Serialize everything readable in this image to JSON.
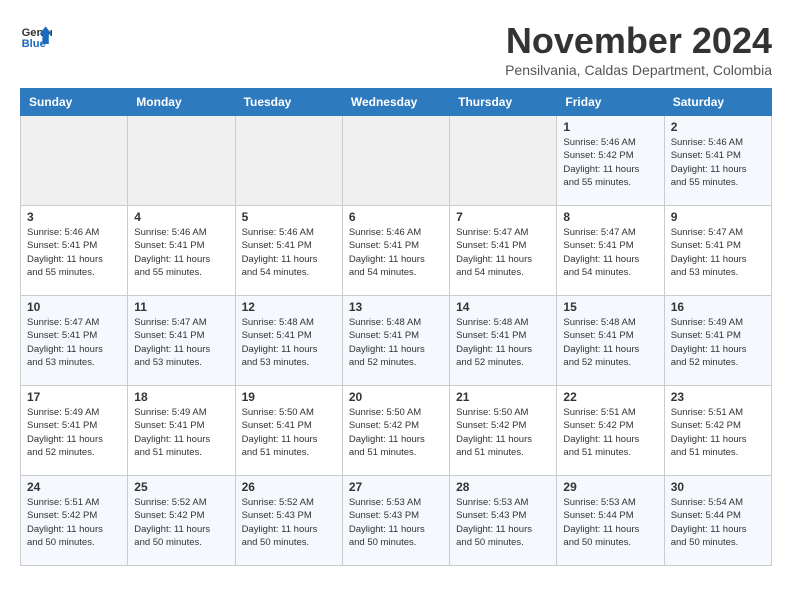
{
  "header": {
    "logo_general": "General",
    "logo_blue": "Blue",
    "month": "November 2024",
    "location": "Pensilvania, Caldas Department, Colombia"
  },
  "weekdays": [
    "Sunday",
    "Monday",
    "Tuesday",
    "Wednesday",
    "Thursday",
    "Friday",
    "Saturday"
  ],
  "weeks": [
    [
      {
        "day": "",
        "info": ""
      },
      {
        "day": "",
        "info": ""
      },
      {
        "day": "",
        "info": ""
      },
      {
        "day": "",
        "info": ""
      },
      {
        "day": "",
        "info": ""
      },
      {
        "day": "1",
        "info": "Sunrise: 5:46 AM\nSunset: 5:42 PM\nDaylight: 11 hours and 55 minutes."
      },
      {
        "day": "2",
        "info": "Sunrise: 5:46 AM\nSunset: 5:41 PM\nDaylight: 11 hours and 55 minutes."
      }
    ],
    [
      {
        "day": "3",
        "info": "Sunrise: 5:46 AM\nSunset: 5:41 PM\nDaylight: 11 hours and 55 minutes."
      },
      {
        "day": "4",
        "info": "Sunrise: 5:46 AM\nSunset: 5:41 PM\nDaylight: 11 hours and 55 minutes."
      },
      {
        "day": "5",
        "info": "Sunrise: 5:46 AM\nSunset: 5:41 PM\nDaylight: 11 hours and 54 minutes."
      },
      {
        "day": "6",
        "info": "Sunrise: 5:46 AM\nSunset: 5:41 PM\nDaylight: 11 hours and 54 minutes."
      },
      {
        "day": "7",
        "info": "Sunrise: 5:47 AM\nSunset: 5:41 PM\nDaylight: 11 hours and 54 minutes."
      },
      {
        "day": "8",
        "info": "Sunrise: 5:47 AM\nSunset: 5:41 PM\nDaylight: 11 hours and 54 minutes."
      },
      {
        "day": "9",
        "info": "Sunrise: 5:47 AM\nSunset: 5:41 PM\nDaylight: 11 hours and 53 minutes."
      }
    ],
    [
      {
        "day": "10",
        "info": "Sunrise: 5:47 AM\nSunset: 5:41 PM\nDaylight: 11 hours and 53 minutes."
      },
      {
        "day": "11",
        "info": "Sunrise: 5:47 AM\nSunset: 5:41 PM\nDaylight: 11 hours and 53 minutes."
      },
      {
        "day": "12",
        "info": "Sunrise: 5:48 AM\nSunset: 5:41 PM\nDaylight: 11 hours and 53 minutes."
      },
      {
        "day": "13",
        "info": "Sunrise: 5:48 AM\nSunset: 5:41 PM\nDaylight: 11 hours and 52 minutes."
      },
      {
        "day": "14",
        "info": "Sunrise: 5:48 AM\nSunset: 5:41 PM\nDaylight: 11 hours and 52 minutes."
      },
      {
        "day": "15",
        "info": "Sunrise: 5:48 AM\nSunset: 5:41 PM\nDaylight: 11 hours and 52 minutes."
      },
      {
        "day": "16",
        "info": "Sunrise: 5:49 AM\nSunset: 5:41 PM\nDaylight: 11 hours and 52 minutes."
      }
    ],
    [
      {
        "day": "17",
        "info": "Sunrise: 5:49 AM\nSunset: 5:41 PM\nDaylight: 11 hours and 52 minutes."
      },
      {
        "day": "18",
        "info": "Sunrise: 5:49 AM\nSunset: 5:41 PM\nDaylight: 11 hours and 51 minutes."
      },
      {
        "day": "19",
        "info": "Sunrise: 5:50 AM\nSunset: 5:41 PM\nDaylight: 11 hours and 51 minutes."
      },
      {
        "day": "20",
        "info": "Sunrise: 5:50 AM\nSunset: 5:42 PM\nDaylight: 11 hours and 51 minutes."
      },
      {
        "day": "21",
        "info": "Sunrise: 5:50 AM\nSunset: 5:42 PM\nDaylight: 11 hours and 51 minutes."
      },
      {
        "day": "22",
        "info": "Sunrise: 5:51 AM\nSunset: 5:42 PM\nDaylight: 11 hours and 51 minutes."
      },
      {
        "day": "23",
        "info": "Sunrise: 5:51 AM\nSunset: 5:42 PM\nDaylight: 11 hours and 51 minutes."
      }
    ],
    [
      {
        "day": "24",
        "info": "Sunrise: 5:51 AM\nSunset: 5:42 PM\nDaylight: 11 hours and 50 minutes."
      },
      {
        "day": "25",
        "info": "Sunrise: 5:52 AM\nSunset: 5:42 PM\nDaylight: 11 hours and 50 minutes."
      },
      {
        "day": "26",
        "info": "Sunrise: 5:52 AM\nSunset: 5:43 PM\nDaylight: 11 hours and 50 minutes."
      },
      {
        "day": "27",
        "info": "Sunrise: 5:53 AM\nSunset: 5:43 PM\nDaylight: 11 hours and 50 minutes."
      },
      {
        "day": "28",
        "info": "Sunrise: 5:53 AM\nSunset: 5:43 PM\nDaylight: 11 hours and 50 minutes."
      },
      {
        "day": "29",
        "info": "Sunrise: 5:53 AM\nSunset: 5:44 PM\nDaylight: 11 hours and 50 minutes."
      },
      {
        "day": "30",
        "info": "Sunrise: 5:54 AM\nSunset: 5:44 PM\nDaylight: 11 hours and 50 minutes."
      }
    ]
  ]
}
